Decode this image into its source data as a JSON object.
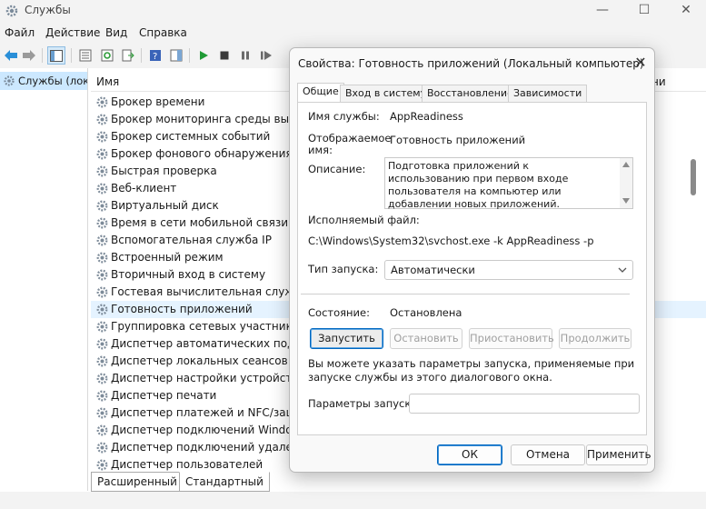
{
  "window": {
    "title": "Службы"
  },
  "menu": [
    "Файл",
    "Действие",
    "Вид",
    "Справка"
  ],
  "tree": {
    "item": "Службы (лок"
  },
  "list": {
    "header_name": "Имя",
    "header_right": "ни",
    "services": [
      "Брокер времени",
      "Брокер мониторинга среды выпол",
      "Брокер системных событий",
      "Брокер фонового обнаружения Dev",
      "Быстрая проверка",
      "Веб-клиент",
      "Виртуальный диск",
      "Время в сети мобильной связи",
      "Вспомогательная служба IP",
      "Встроенный режим",
      "Вторичный вход в систему",
      "Гостевая вычислительная служба H",
      "Готовность приложений",
      "Группировка сетевых участников",
      "Диспетчер автоматических подклю",
      "Диспетчер локальных сеансов",
      "Диспетчер настройки устройств",
      "Диспетчер печати",
      "Диспетчер платежей и NFC/защищ",
      "Диспетчер подключений Windows",
      "Диспетчер подключений удаленн",
      "Диспетчер пользователей"
    ]
  },
  "bottom_tabs": [
    "Расширенный",
    "Стандартный"
  ],
  "dialog": {
    "title": "Свойства: Готовность приложений (Локальный компьютер)",
    "tabs": [
      "Общие",
      "Вход в систему",
      "Восстановление",
      "Зависимости"
    ],
    "service_name_label": "Имя службы:",
    "service_name": "AppReadiness",
    "display_name_label_1": "Отображаемое",
    "display_name_label_2": "имя:",
    "display_name": "Готовность приложений",
    "description_label": "Описание:",
    "description": "Подготовка приложений к использованию при первом входе пользователя на компьютер или добавлении новых приложений.",
    "exe_label": "Исполняемый файл:",
    "exe_path": "C:\\Windows\\System32\\svchost.exe -k AppReadiness -p",
    "startup_label": "Тип запуска:",
    "startup_value": "Автоматически",
    "status_label": "Состояние:",
    "status_value": "Остановлена",
    "btn_start": "Запустить",
    "btn_stop": "Остановить",
    "btn_pause": "Приостановить",
    "btn_resume": "Продолжить",
    "info": "Вы можете указать параметры запуска, применяемые при запуске службы из этого диалогового окна.",
    "params_label": "Параметры запуска:",
    "params_value": "",
    "btn_ok": "ОК",
    "btn_cancel": "Отмена",
    "btn_apply": "Применить"
  }
}
